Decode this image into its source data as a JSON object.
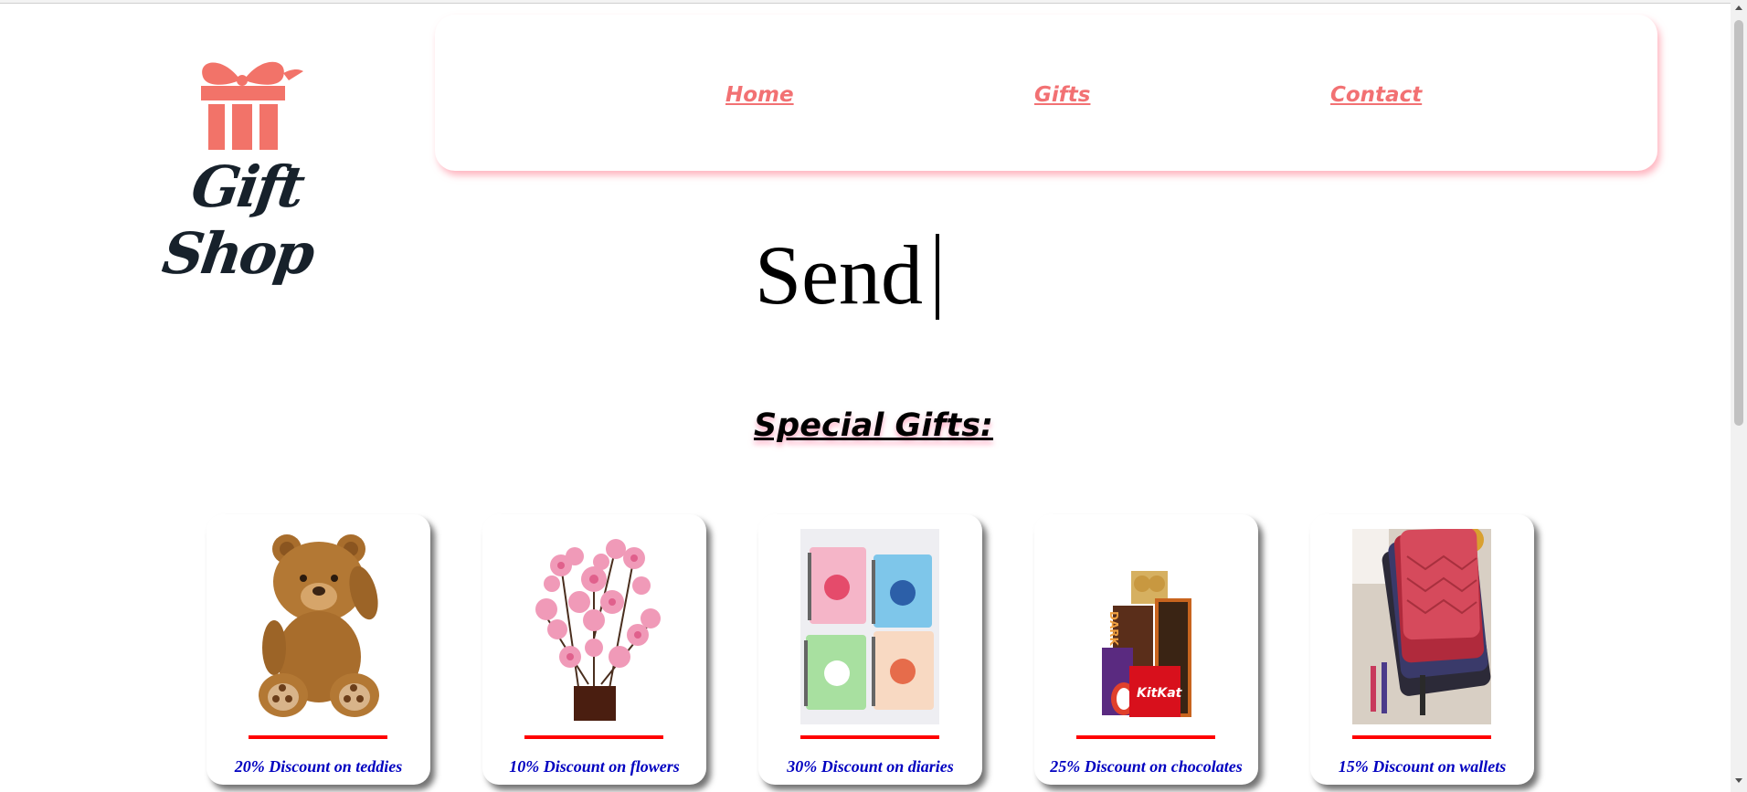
{
  "logo": {
    "text": "Gift Shop",
    "icon": "gift-box-icon",
    "icon_color": "#f27369",
    "text_color": "#17212b"
  },
  "nav": {
    "items": [
      {
        "label": "Home"
      },
      {
        "label": "Gifts"
      },
      {
        "label": "Contact"
      }
    ],
    "link_color": "#f27173"
  },
  "hero": {
    "text": "Send"
  },
  "section": {
    "title": "Special Gifts:"
  },
  "cards": [
    {
      "caption": "20% Discount on teddies",
      "image": "teddy-bear"
    },
    {
      "caption": "10% Discount on flowers",
      "image": "flower-vase"
    },
    {
      "caption": "30% Discount on diaries",
      "image": "diaries"
    },
    {
      "caption": "25% Discount on chocolates",
      "image": "chocolates"
    },
    {
      "caption": "15% Discount on wallets",
      "image": "wallets"
    }
  ],
  "colors": {
    "caption": "#0000c0",
    "rule": "#ff0000",
    "nav_shadow": "#ff7890"
  }
}
